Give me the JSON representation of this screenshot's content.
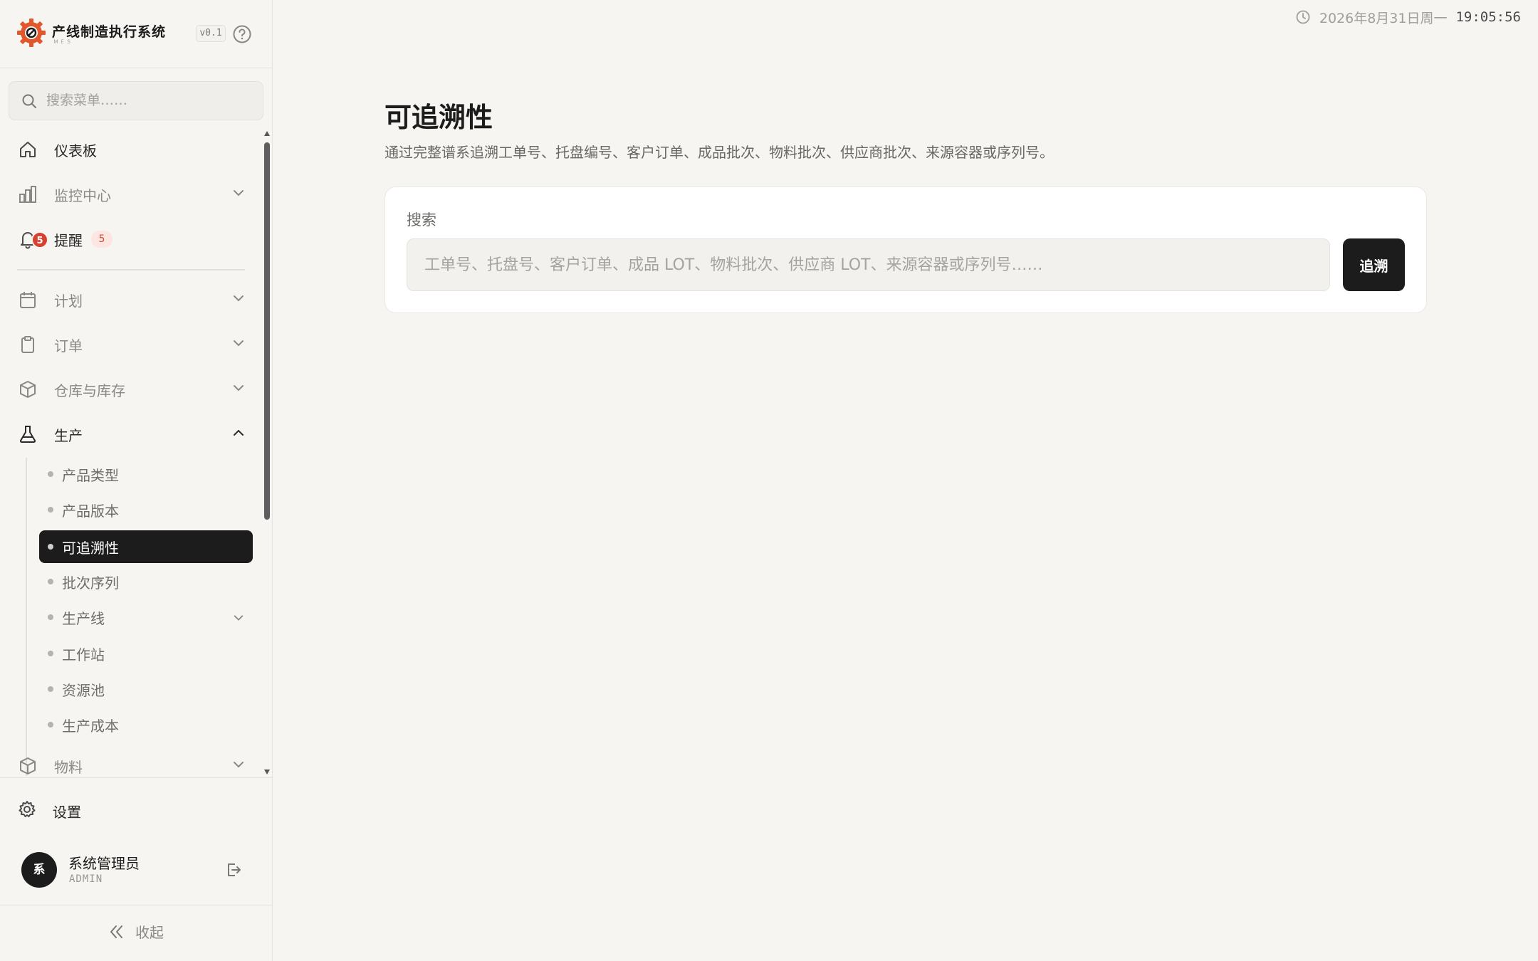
{
  "brand": {
    "title": "产线制造执行系统",
    "subtitle": "ＭＥＳ",
    "version": "v0.1"
  },
  "sidebar": {
    "search_placeholder": "搜索菜单……",
    "nav": {
      "dashboard": "仪表板",
      "monitor": "监控中心",
      "alerts": "提醒",
      "alerts_count": "5",
      "plan": "计划",
      "orders": "订单",
      "warehouse": "仓库与库存",
      "production": "生产",
      "materials": "物料"
    },
    "production_sub": {
      "product_types": "产品类型",
      "product_versions": "产品版本",
      "traceability": "可追溯性",
      "batch_sequence": "批次序列",
      "production_line": "生产线",
      "workstation": "工作站",
      "resource_pool": "资源池",
      "production_cost": "生产成本"
    },
    "settings": "设置",
    "user": {
      "avatar_text": "系",
      "name": "系统管理员",
      "role": "ADMIN"
    },
    "collapse": "收起"
  },
  "header": {
    "date": "2026年8月31日周一",
    "time": "19:05:56"
  },
  "main": {
    "title": "可追溯性",
    "description": "通过完整谱系追溯工单号、托盘编号、客户订单、成品批次、物料批次、供应商批次、来源容器或序列号。",
    "search_label": "搜索",
    "search_placeholder": "工单号、托盘号、客户订单、成品 LOT、物料批次、供应商 LOT、来源容器或序列号……",
    "trace_button": "追溯"
  },
  "colors": {
    "accent": "#1c1c1c",
    "logo_orange": "#e2572b",
    "badge_red": "#d8412f",
    "background": "#f6f5f2"
  }
}
